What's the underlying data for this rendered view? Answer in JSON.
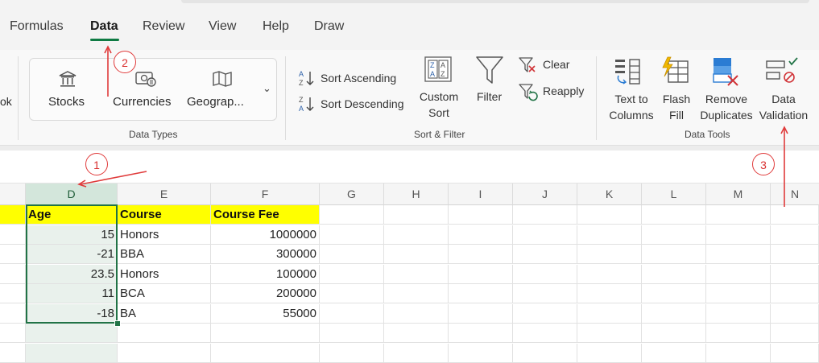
{
  "tabs": [
    {
      "label": "Formulas",
      "active": false
    },
    {
      "label": "Data",
      "active": true
    },
    {
      "label": "Review",
      "active": false
    },
    {
      "label": "View",
      "active": false
    },
    {
      "label": "Help",
      "active": false
    },
    {
      "label": "Draw",
      "active": false
    }
  ],
  "ribbon": {
    "cutoff_label": "ok",
    "data_types": {
      "group_label": "Data Types",
      "stocks": "Stocks",
      "currencies": "Currencies",
      "geography": "Geograp...",
      "more_icon": "chevron-down-icon"
    },
    "sort_filter": {
      "group_label": "Sort & Filter",
      "sort_ascending": "Sort Ascending",
      "sort_descending": "Sort Descending",
      "custom_sort_line1": "Custom",
      "custom_sort_line2": "Sort",
      "filter": "Filter",
      "clear": "Clear",
      "reapply": "Reapply"
    },
    "data_tools": {
      "group_label": "Data Tools",
      "text_to_columns_line1": "Text to",
      "text_to_columns_line2": "Columns",
      "flash_fill_line1": "Flash",
      "flash_fill_line2": "Fill",
      "remove_duplicates_line1": "Remove",
      "remove_duplicates_line2": "Duplicates",
      "data_validation_line1": "Data",
      "data_validation_line2": "Validation"
    }
  },
  "grid": {
    "columns": [
      "D",
      "E",
      "F",
      "G",
      "H",
      "I",
      "J",
      "K",
      "L",
      "M",
      "N"
    ],
    "selected_column": "D",
    "headers": {
      "age": "Age",
      "course": "Course",
      "course_fee": "Course Fee"
    },
    "rows": [
      {
        "age": "15",
        "course": "Honors",
        "fee": "1000000"
      },
      {
        "age": "-21",
        "course": "BBA",
        "fee": "300000"
      },
      {
        "age": "23.5",
        "course": "Honors",
        "fee": "100000"
      },
      {
        "age": "11",
        "course": "BCA",
        "fee": "200000"
      },
      {
        "age": "-18",
        "course": "BA",
        "fee": "55000"
      }
    ]
  },
  "annotations": {
    "step1": "1",
    "step2": "2",
    "step3": "3"
  },
  "colors": {
    "accent_green": "#217346",
    "highlight_yellow": "#ffff00",
    "annotation_red": "#e03b3b"
  }
}
